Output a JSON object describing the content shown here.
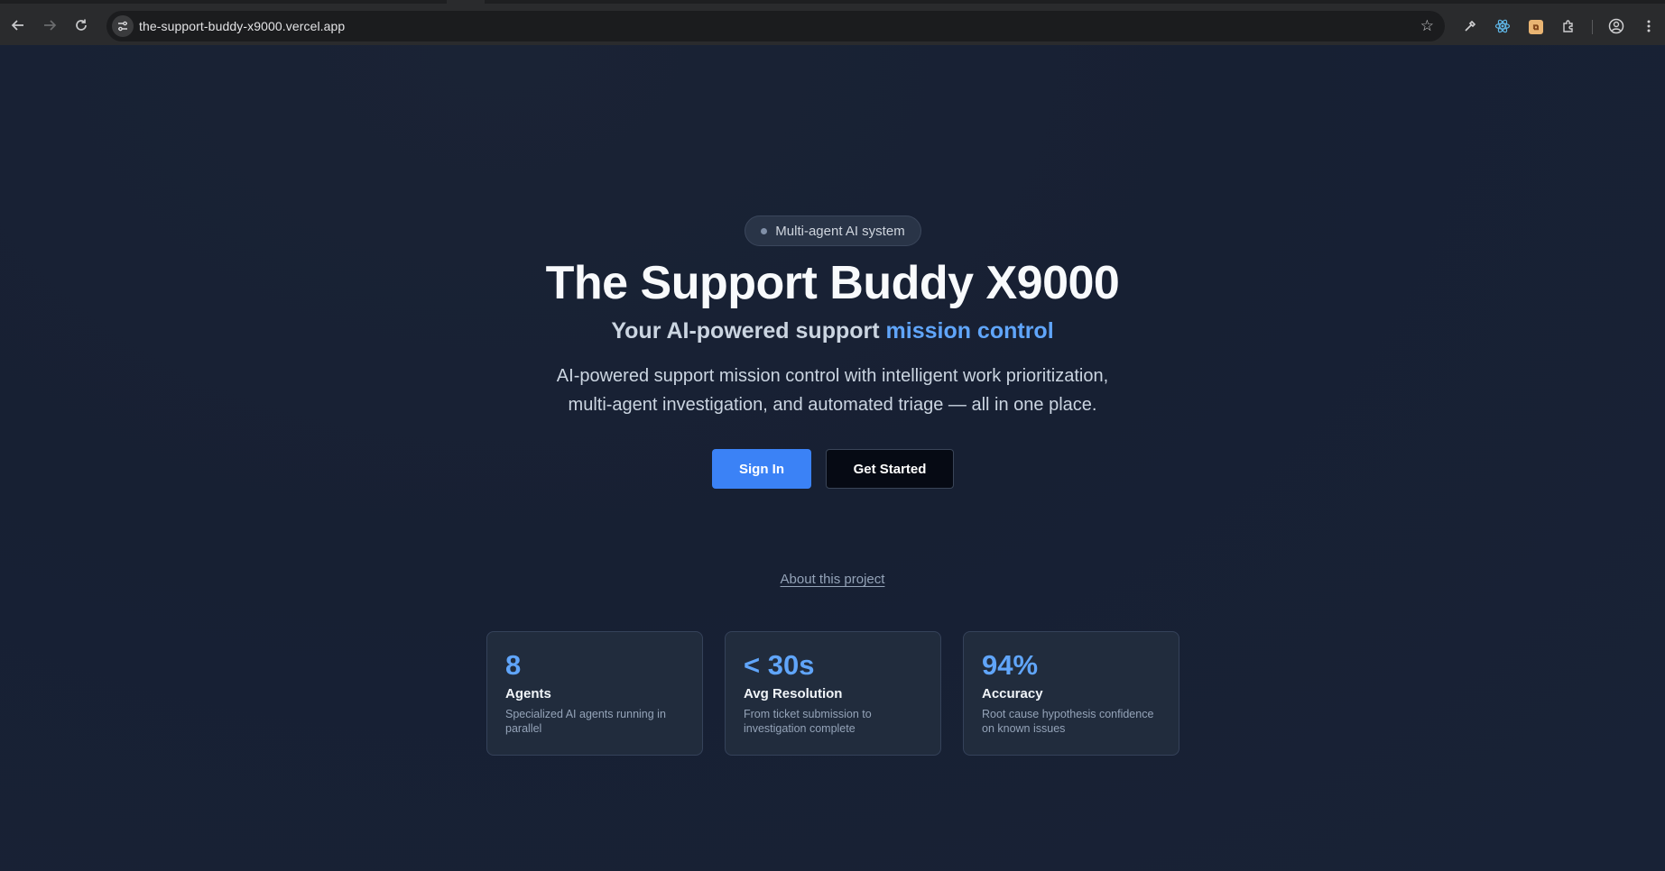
{
  "browser": {
    "url": "the-support-buddy-x9000.vercel.app",
    "back_icon": "arrow-left-icon",
    "forward_icon": "arrow-right-icon",
    "reload_icon": "reload-icon"
  },
  "hero": {
    "badge": "Multi-agent AI system",
    "title": "The Support Buddy X9000",
    "subtitle_prefix": "Your AI-powered support ",
    "subtitle_accent": "mission control",
    "description_line1": "AI-powered support mission control with intelligent work prioritization,",
    "description_line2": "multi-agent investigation, and automated triage — all in one place.",
    "sign_in": "Sign In",
    "get_started": "Get Started",
    "about_link": "About this project"
  },
  "stats": [
    {
      "value": "8",
      "label": "Agents",
      "note": "Specialized AI agents running in parallel"
    },
    {
      "value": "< 30s",
      "label": "Avg Resolution",
      "note": "From ticket submission to investigation complete"
    },
    {
      "value": "94%",
      "label": "Accuracy",
      "note": "Root cause hypothesis confidence on known issues"
    }
  ],
  "colors": {
    "accent": "#60a5fa",
    "primary_button": "#3b82f6",
    "background": "#172033"
  }
}
